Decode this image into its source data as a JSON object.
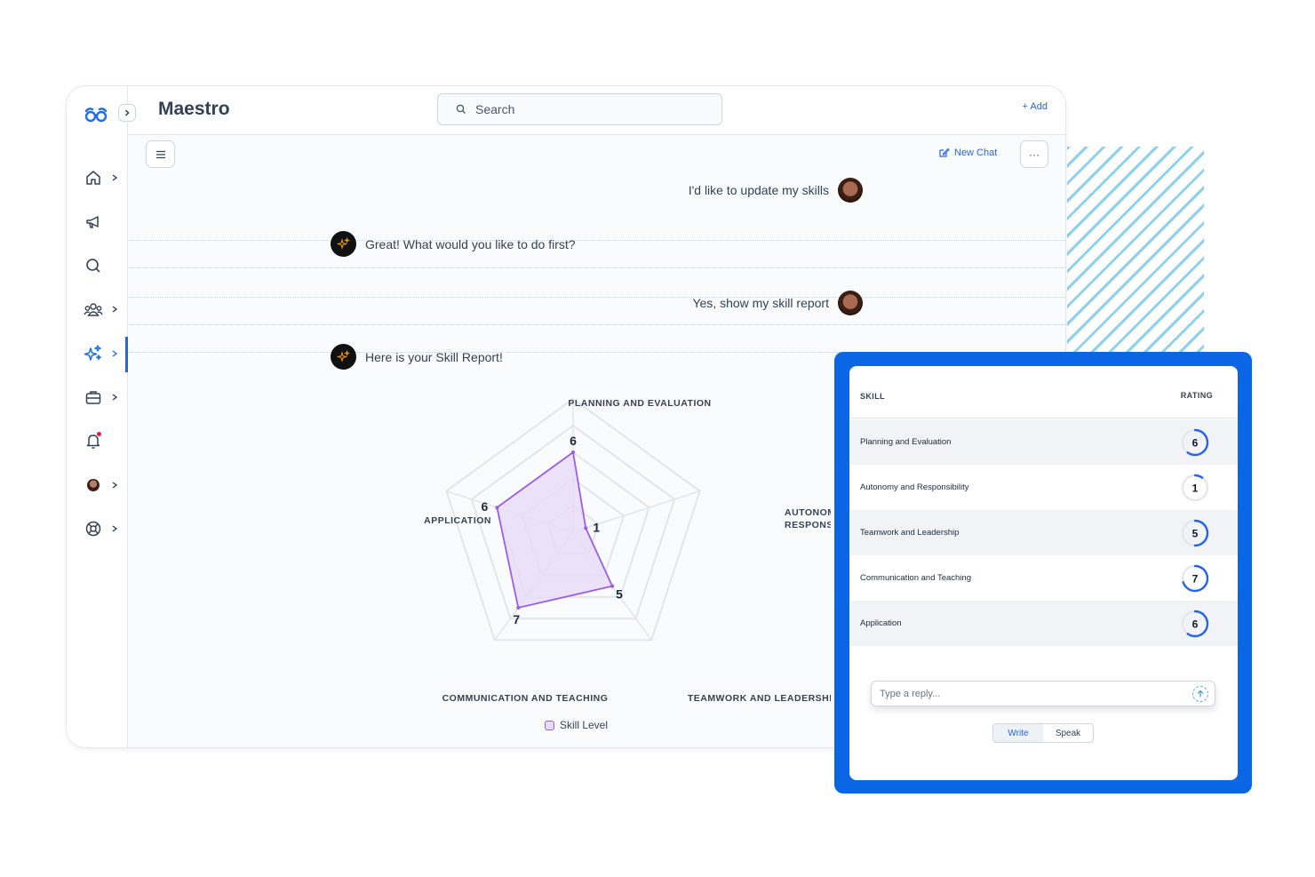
{
  "app": {
    "title": "Maestro"
  },
  "search": {
    "placeholder": "Search"
  },
  "header": {
    "add_label": "+ Add"
  },
  "toolbar": {
    "new_chat_label": "New Chat",
    "more_label": "···"
  },
  "sidebar": {
    "items": [
      {
        "name": "home",
        "icon": "home-icon",
        "has_chevron": true
      },
      {
        "name": "announcements",
        "icon": "megaphone-icon",
        "has_chevron": false
      },
      {
        "name": "search",
        "icon": "search-icon",
        "has_chevron": false
      },
      {
        "name": "people",
        "icon": "people-icon",
        "has_chevron": true
      },
      {
        "name": "ai",
        "icon": "sparkles-icon",
        "has_chevron": true,
        "active": true
      },
      {
        "name": "jobs",
        "icon": "briefcase-icon",
        "has_chevron": true
      },
      {
        "name": "notifications",
        "icon": "bell-icon",
        "has_chevron": false,
        "badge": true
      },
      {
        "name": "profile",
        "icon": "avatar-icon",
        "has_chevron": true
      },
      {
        "name": "help",
        "icon": "lifebuoy-icon",
        "has_chevron": true
      }
    ]
  },
  "chat": {
    "messages": [
      {
        "role": "user",
        "text": "I'd like to update my skills"
      },
      {
        "role": "assistant",
        "text": "Great! What would you like to do first?"
      },
      {
        "role": "user",
        "text": "Yes, show my skill report"
      },
      {
        "role": "assistant",
        "text": "Here is your Skill Report!"
      }
    ]
  },
  "chart_data": {
    "type": "radar",
    "categories": [
      "PLANNING AND EVALUATION",
      "AUTONOMY AND RESPONSIBILITY",
      "TEAMWORK AND LEADERSHIP",
      "COMMUNICATION AND TEACHING",
      "APPLICATION"
    ],
    "series": [
      {
        "name": "Skill Level",
        "values": [
          6,
          1,
          5,
          7,
          6
        ]
      }
    ],
    "rlim": [
      0,
      10
    ],
    "grid": true,
    "legend": "bottom",
    "colors": {
      "fill": "#e7dcf7",
      "stroke": "#9b5de5"
    }
  },
  "skill_table": {
    "headers": {
      "skill": "SKILL",
      "rating": "RATING"
    },
    "rows": [
      {
        "skill": "Planning and Evaluation",
        "rating": 6
      },
      {
        "skill": "Autonomy and Responsibility",
        "rating": 1
      },
      {
        "skill": "Teamwork and Leadership",
        "rating": 5
      },
      {
        "skill": "Communication and Teaching",
        "rating": 7
      },
      {
        "skill": "Application",
        "rating": 6
      }
    ],
    "rating_max": 10
  },
  "reply": {
    "placeholder": "Type a reply..."
  },
  "mode": {
    "write_label": "Write",
    "speak_label": "Speak",
    "selected": "Write"
  },
  "colors": {
    "accent": "#2563eb",
    "panel_border": "#0a66e4",
    "stripes": "#8fd0ef"
  }
}
